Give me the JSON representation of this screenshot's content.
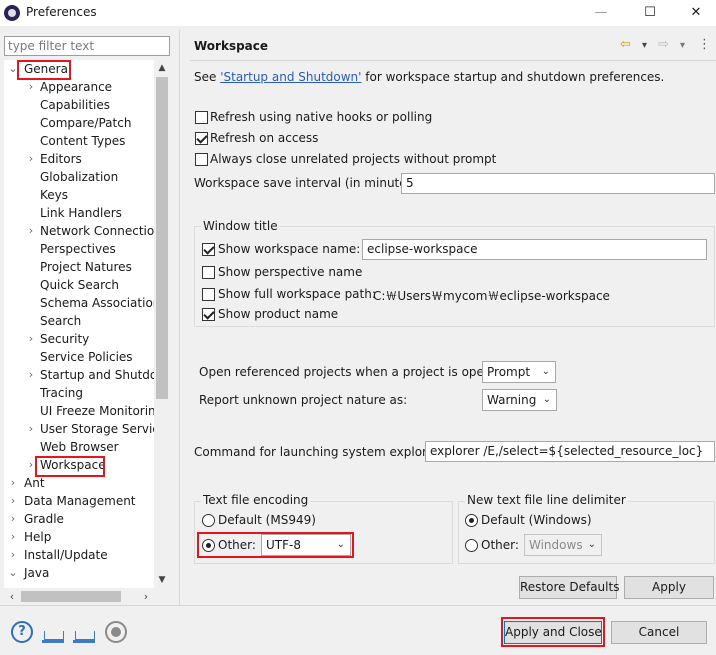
{
  "window": {
    "title": "Preferences",
    "minimize_glyph": "—",
    "maximize_glyph": "☐",
    "close_glyph": "✕"
  },
  "filter": {
    "placeholder": "type filter text"
  },
  "tree": {
    "items": [
      {
        "label": "General",
        "arrow": "⌄"
      },
      {
        "label": "Appearance",
        "arrow": "›"
      },
      {
        "label": "Capabilities",
        "arrow": ""
      },
      {
        "label": "Compare/Patch",
        "arrow": ""
      },
      {
        "label": "Content Types",
        "arrow": ""
      },
      {
        "label": "Editors",
        "arrow": "›"
      },
      {
        "label": "Globalization",
        "arrow": ""
      },
      {
        "label": "Keys",
        "arrow": ""
      },
      {
        "label": "Link Handlers",
        "arrow": ""
      },
      {
        "label": "Network Connections",
        "arrow": "›"
      },
      {
        "label": "Perspectives",
        "arrow": ""
      },
      {
        "label": "Project Natures",
        "arrow": ""
      },
      {
        "label": "Quick Search",
        "arrow": ""
      },
      {
        "label": "Schema Associations",
        "arrow": ""
      },
      {
        "label": "Search",
        "arrow": ""
      },
      {
        "label": "Security",
        "arrow": "›"
      },
      {
        "label": "Service Policies",
        "arrow": ""
      },
      {
        "label": "Startup and Shutdown",
        "arrow": "›"
      },
      {
        "label": "Tracing",
        "arrow": ""
      },
      {
        "label": "UI Freeze Monitoring",
        "arrow": ""
      },
      {
        "label": "User Storage Service",
        "arrow": "›"
      },
      {
        "label": "Web Browser",
        "arrow": ""
      },
      {
        "label": "Workspace",
        "arrow": "›"
      },
      {
        "label": "Ant",
        "arrow": "›"
      },
      {
        "label": "Data Management",
        "arrow": "›"
      },
      {
        "label": "Gradle",
        "arrow": "›"
      },
      {
        "label": "Help",
        "arrow": "›"
      },
      {
        "label": "Install/Update",
        "arrow": "›"
      },
      {
        "label": "Java",
        "arrow": "⌄"
      }
    ]
  },
  "page": {
    "title": "Workspace",
    "intro_prefix": "See ",
    "intro_link": "'Startup and Shutdown'",
    "intro_suffix": " for workspace startup and shutdown preferences.",
    "refresh_native": "Refresh using native hooks or polling",
    "refresh_access": "Refresh on access",
    "always_close": "Always close unrelated projects without prompt",
    "save_interval_label": "Workspace save interval (in minutes):",
    "save_interval_value": "5",
    "window_title_group": "Window title",
    "show_ws_name": "Show workspace name:",
    "ws_name_value": "eclipse-workspace",
    "show_perspective": "Show perspective name",
    "show_full_path": "Show full workspace path:",
    "full_path_value": "C:￦Users￦mycom￦eclipse-workspace",
    "show_product": "Show product name",
    "open_ref_label": "Open referenced projects when a project is opened:",
    "open_ref_value": "Prompt",
    "unknown_nature_label": "Report unknown project nature as:",
    "unknown_nature_value": "Warning",
    "explorer_label": "Command for launching system explorer:",
    "explorer_value": "explorer /E,/select=${selected_resource_loc}",
    "encoding_group": "Text file encoding",
    "encoding_default": "Default (MS949)",
    "encoding_other": "Other:",
    "encoding_value": "UTF-8",
    "delimiter_group": "New text file line delimiter",
    "delimiter_default": "Default (Windows)",
    "delimiter_other": "Other:",
    "delimiter_value": "Windows",
    "restore_defaults": "Restore Defaults",
    "apply": "Apply"
  },
  "footer": {
    "apply_close": "Apply and Close",
    "cancel": "Cancel",
    "help_glyph": "?"
  },
  "nav": {
    "back": "⇦",
    "menu1": "▾",
    "forward": "⇨",
    "menu2": "▾",
    "more": "⋮"
  },
  "colors": {
    "highlight_red": "#e8141d",
    "link_blue": "#2a5bb7",
    "primary_border": "#0078d7"
  }
}
